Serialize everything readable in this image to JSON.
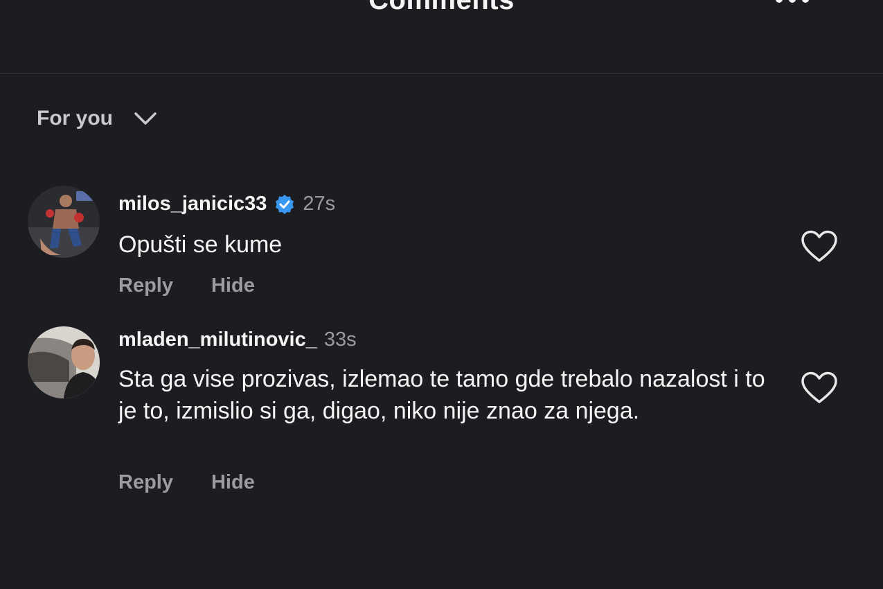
{
  "header": {
    "title": "Comments",
    "more_icon": "more-horizontal-icon"
  },
  "filter": {
    "label": "For you",
    "icon": "chevron-down-icon"
  },
  "comments": [
    {
      "username": "milos_janicic33",
      "verified": true,
      "time": "27s",
      "text": "Opušti se kume",
      "reply_label": "Reply",
      "hide_label": "Hide",
      "avatar": "avatar-fighter-photo"
    },
    {
      "username": "mladen_milutinovic_",
      "verified": false,
      "time": "33s",
      "text": "Sta ga vise prozivas, izlemao te tamo gde trebalo nazalost i to je to, izmislio si ga, digao, niko nije znao za njega.",
      "reply_label": "Reply",
      "hide_label": "Hide",
      "avatar": "avatar-man-photo"
    }
  ],
  "colors": {
    "background": "#1c1d20",
    "text": "#f5f5f5",
    "muted": "#9a9ca1",
    "verified": "#3897f0"
  }
}
